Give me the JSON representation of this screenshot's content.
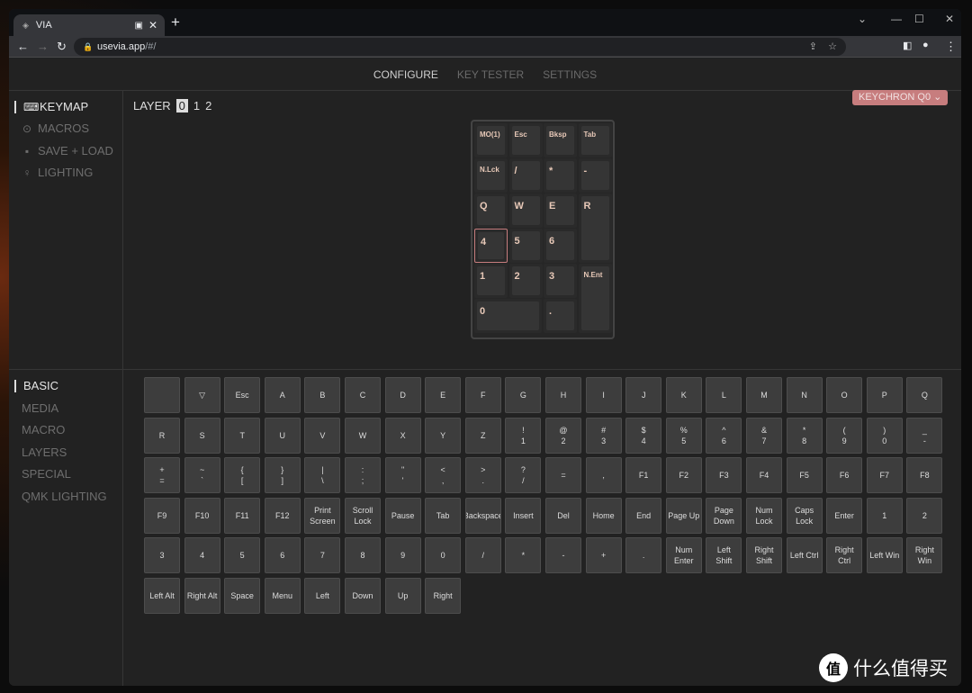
{
  "browser": {
    "tab_title": "VIA",
    "url_host": "usevia.app",
    "url_path": "/#/"
  },
  "topnav": [
    {
      "label": "CONFIGURE",
      "active": true
    },
    {
      "label": "KEY TESTER"
    },
    {
      "label": "SETTINGS"
    }
  ],
  "sidebar": {
    "items": [
      {
        "label": "KEYMAP",
        "icon": "keyboard-icon",
        "active": true
      },
      {
        "label": "MACROS",
        "icon": "record-icon"
      },
      {
        "label": "SAVE + LOAD",
        "icon": "floppy-icon"
      },
      {
        "label": "LIGHTING",
        "icon": "lightbulb-icon"
      }
    ]
  },
  "layer": {
    "label": "LAYER",
    "options": [
      "0",
      "1",
      "2"
    ],
    "selected": "0"
  },
  "device": {
    "label": "KEYCHRON Q0",
    "color": "#c77d7e"
  },
  "numpad": [
    "MO(1)",
    "Esc",
    "Bksp",
    "Tab",
    "N.Lck",
    "/",
    "*",
    "-",
    "Q",
    "W",
    "E",
    "R",
    "4",
    "5",
    "6",
    "1",
    "2",
    "3",
    "N.Ent",
    "0",
    "."
  ],
  "categories": [
    {
      "label": "BASIC",
      "active": true
    },
    {
      "label": "MEDIA"
    },
    {
      "label": "MACRO"
    },
    {
      "label": "LAYERS"
    },
    {
      "label": "SPECIAL"
    },
    {
      "label": "QMK LIGHTING"
    }
  ],
  "keys": [
    [
      "",
      "▽",
      "Esc",
      "A",
      "B",
      "C",
      "D",
      "E",
      "F",
      "G",
      "H",
      "I",
      "J",
      "K",
      "L",
      "M",
      "N",
      "O",
      "P",
      "Q"
    ],
    [
      "R",
      "S",
      "T",
      "U",
      "V",
      "W",
      "X",
      "Y",
      "Z",
      "!\n1",
      "@\n2",
      "#\n3",
      "$\n4",
      "%\n5",
      "^\n6",
      "&\n7",
      "*\n8",
      "(\n9",
      ")\n0",
      "_\n-"
    ],
    [
      "+\n=",
      "~\n`",
      "{\n[",
      "}\n]",
      "|\n\\",
      ":\n;",
      "\"\n'",
      "<\n,",
      ">\n.",
      "?\n/",
      "=",
      ",",
      "F1",
      "F2",
      "F3",
      "F4",
      "F5",
      "F6",
      "F7",
      "F8"
    ],
    [
      "F9",
      "F10",
      "F11",
      "F12",
      "Print\nScreen",
      "Scroll\nLock",
      "Pause",
      "Tab",
      "Backspace",
      "Insert",
      "Del",
      "Home",
      "End",
      "Page Up",
      "Page\nDown",
      "Num\nLock",
      "Caps\nLock",
      "Enter",
      "1",
      "2"
    ],
    [
      "3",
      "4",
      "5",
      "6",
      "7",
      "8",
      "9",
      "0",
      "/",
      "*",
      "-",
      "+",
      ".",
      "Num\nEnter",
      "Left\nShift",
      "Right\nShift",
      "Left Ctrl",
      "Right\nCtrl",
      "Left Win",
      "Right\nWin"
    ],
    [
      "Left Alt",
      "Right Alt",
      "Space",
      "Menu",
      "Left",
      "Down",
      "Up",
      "Right"
    ]
  ],
  "watermark": {
    "logo": "值",
    "text": "什么值得买"
  }
}
